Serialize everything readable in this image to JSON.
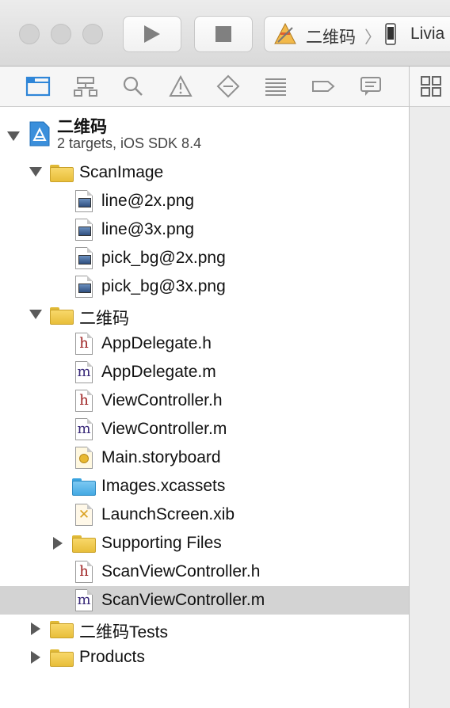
{
  "titlebar": {
    "scheme_name": "二维码",
    "device_name": "Livia"
  },
  "navigator": {
    "icons": [
      "project-navigator-icon",
      "symbol-navigator-icon",
      "find-navigator-icon",
      "issue-navigator-icon",
      "test-navigator-icon",
      "debug-navigator-icon",
      "breakpoint-navigator-icon",
      "report-navigator-icon"
    ]
  },
  "tree": {
    "project": {
      "name": "二维码",
      "subtitle": "2 targets, iOS SDK 8.4"
    },
    "scanimage_folder": "ScanImage",
    "scanimage_files": [
      "line@2x.png",
      "line@3x.png",
      "pick_bg@2x.png",
      "pick_bg@3x.png"
    ],
    "group_folder": "二维码",
    "files": [
      {
        "name": "AppDelegate.h",
        "kind": "h"
      },
      {
        "name": "AppDelegate.m",
        "kind": "m"
      },
      {
        "name": "ViewController.h",
        "kind": "h"
      },
      {
        "name": "ViewController.m",
        "kind": "m"
      },
      {
        "name": "Main.storyboard",
        "kind": "storyboard"
      },
      {
        "name": "Images.xcassets",
        "kind": "xcassets"
      },
      {
        "name": "LaunchScreen.xib",
        "kind": "xib"
      },
      {
        "name": "Supporting Files",
        "kind": "folder"
      },
      {
        "name": "ScanViewController.h",
        "kind": "h"
      },
      {
        "name": "ScanViewController.m",
        "kind": "m"
      }
    ],
    "tests_folder": "二维码Tests",
    "products_folder": "Products",
    "selected": "ScanViewController.m"
  },
  "colors": {
    "selection": "#d3d3d3",
    "h_letter": "#9b1b1b",
    "m_letter": "#3a2a7a"
  }
}
